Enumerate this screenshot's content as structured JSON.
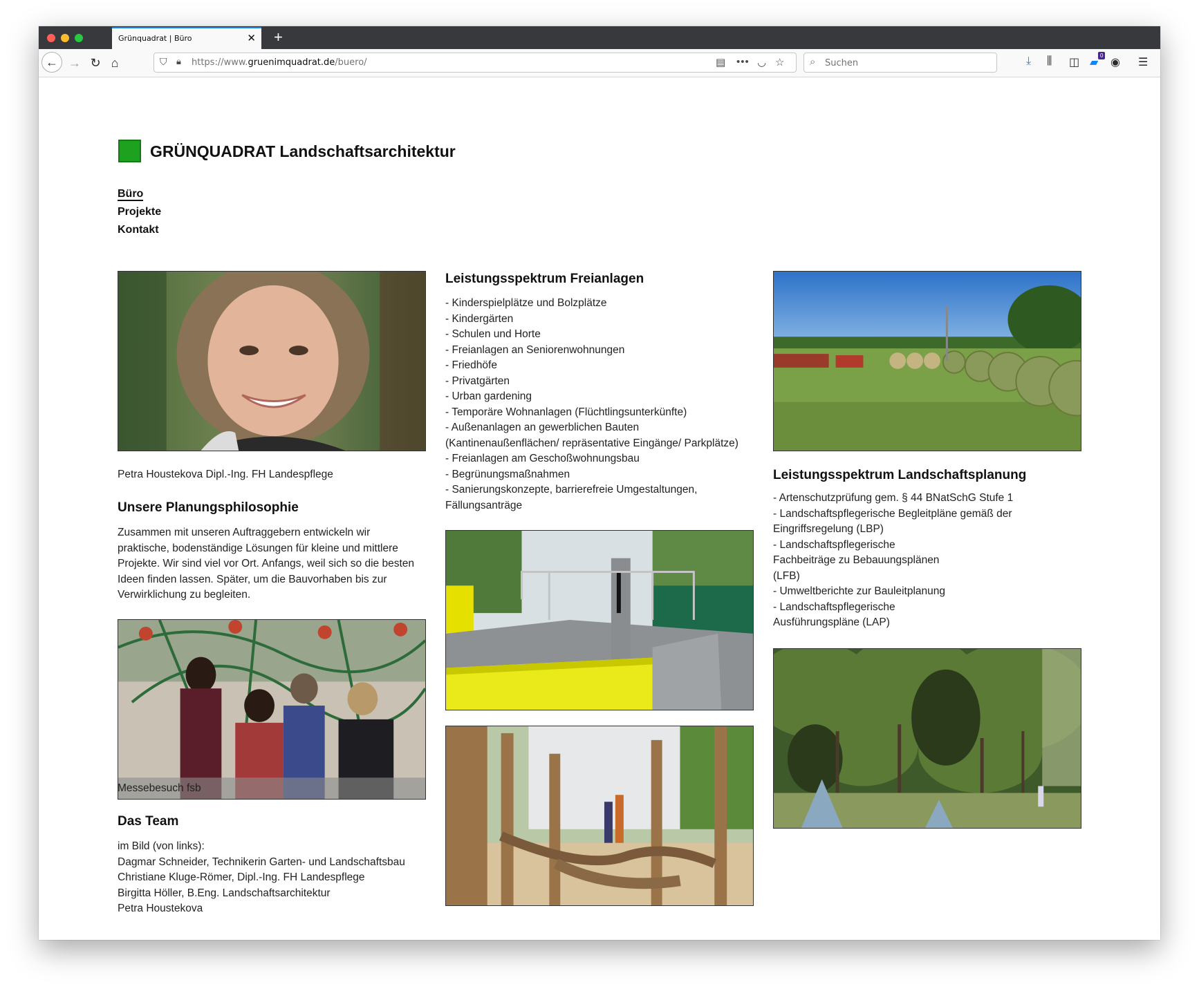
{
  "browser": {
    "tab_title": "Grünquadrat | Büro",
    "url_prefix": "https://www.",
    "url_host": "gruenimquadrat.de",
    "url_path": "/buero/",
    "search_placeholder": "Suchen",
    "notification_badge": "0"
  },
  "site": {
    "brand": "GRÜNQUADRAT Landschaftsarchitektur",
    "brand_color": "#1ea11e",
    "nav": [
      "Büro",
      "Projekte",
      "Kontakt"
    ]
  },
  "left_column": {
    "portrait_caption": "Petra Houstekova Dipl.-Ing. FH Landespflege",
    "philosophy_heading": "Unsere Planungsphilosophie",
    "philosophy_lines": [
      "Zusammen mit unseren Auftraggebern entwickeln wir",
      "praktische, bodenständige Lösungen für kleine und mittlere",
      "Projekte. Wir sind viel vor Ort. Anfangs, weil sich so die besten",
      "Ideen finden lassen. Später, um die Bauvorhaben bis zur",
      "Verwirklichung zu begleiten."
    ],
    "team_photo_caption": "Messebesuch fsb",
    "team_heading": "Das Team",
    "team_lines": [
      "im Bild (von links):",
      "Dagmar Schneider, Technikerin Garten- und Landschaftsbau",
      "Christiane Kluge-Römer, Dipl.-Ing. FH Landespflege",
      "Birgitta Höller, B.Eng. Landschaftsarchitektur",
      "Petra Houstekova"
    ]
  },
  "middle_column": {
    "heading": "Leistungsspektrum Freianlagen",
    "lines": [
      "- Kinderspielplätze und Bolzplätze",
      "- Kindergärten",
      "- Schulen und Horte",
      "- Freianlagen an Seniorenwohnungen",
      "- Friedhöfe",
      "- Privatgärten",
      "- Urban gardening",
      "- Temporäre Wohnanlagen (Flüchtlingsunterkünfte)",
      "- Außenanlagen an gewerblichen Bauten",
      "(Kantinenaußenflächen/ repräsentative Eingänge/ Parkplätze)",
      "- Freianlagen am Geschoßwohnungsbau",
      "- Begrünungsmaßnahmen",
      "- Sanierungskonzepte, barrierefreie Umgestaltungen,",
      "Fällungsanträge"
    ]
  },
  "right_column": {
    "heading": "Leistungsspektrum Landschaftsplanung",
    "lines": [
      "- Artenschutzprüfung gem. § 44 BNatSchG Stufe 1",
      "- Landschaftspflegerische Begleitpläne gemäß der",
      "Eingriffsregelung (LBP)",
      "- Landschaftspflegerische",
      "Fachbeiträge zu Bebauungsplänen",
      "(LFB)",
      "- Umweltberichte zur Bauleitplanung",
      "- Landschaftspflegerische",
      "Ausführungspläne (LAP)"
    ]
  }
}
